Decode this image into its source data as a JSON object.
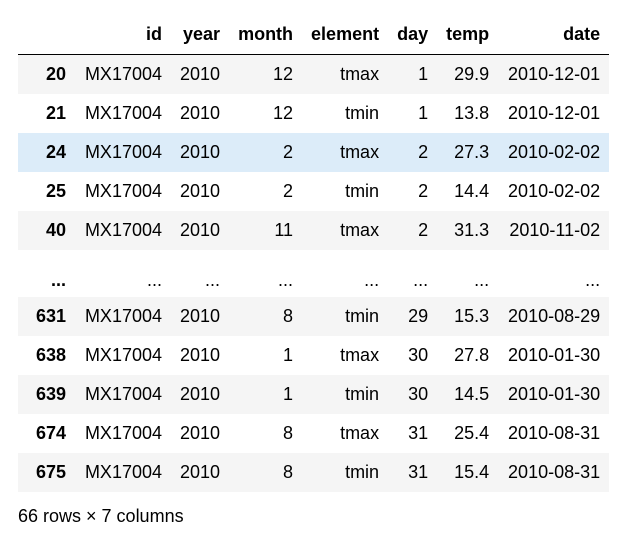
{
  "table": {
    "columns": [
      "",
      "id",
      "year",
      "month",
      "element",
      "day",
      "temp",
      "date"
    ],
    "rows": [
      {
        "index": "20",
        "id": "MX17004",
        "year": "2010",
        "month": "12",
        "element": "tmax",
        "day": "1",
        "temp": "29.9",
        "date": "2010-12-01"
      },
      {
        "index": "21",
        "id": "MX17004",
        "year": "2010",
        "month": "12",
        "element": "tmin",
        "day": "1",
        "temp": "13.8",
        "date": "2010-12-01"
      },
      {
        "index": "24",
        "id": "MX17004",
        "year": "2010",
        "month": "2",
        "element": "tmax",
        "day": "2",
        "temp": "27.3",
        "date": "2010-02-02"
      },
      {
        "index": "25",
        "id": "MX17004",
        "year": "2010",
        "month": "2",
        "element": "tmin",
        "day": "2",
        "temp": "14.4",
        "date": "2010-02-02"
      },
      {
        "index": "40",
        "id": "MX17004",
        "year": "2010",
        "month": "11",
        "element": "tmax",
        "day": "2",
        "temp": "31.3",
        "date": "2010-11-02"
      },
      {
        "index": "...",
        "id": "...",
        "year": "...",
        "month": "...",
        "element": "...",
        "day": "...",
        "temp": "...",
        "date": "..."
      },
      {
        "index": "631",
        "id": "MX17004",
        "year": "2010",
        "month": "8",
        "element": "tmin",
        "day": "29",
        "temp": "15.3",
        "date": "2010-08-29"
      },
      {
        "index": "638",
        "id": "MX17004",
        "year": "2010",
        "month": "1",
        "element": "tmax",
        "day": "30",
        "temp": "27.8",
        "date": "2010-01-30"
      },
      {
        "index": "639",
        "id": "MX17004",
        "year": "2010",
        "month": "1",
        "element": "tmin",
        "day": "30",
        "temp": "14.5",
        "date": "2010-01-30"
      },
      {
        "index": "674",
        "id": "MX17004",
        "year": "2010",
        "month": "8",
        "element": "tmax",
        "day": "31",
        "temp": "25.4",
        "date": "2010-08-31"
      },
      {
        "index": "675",
        "id": "MX17004",
        "year": "2010",
        "month": "8",
        "element": "tmin",
        "day": "31",
        "temp": "15.4",
        "date": "2010-08-31"
      }
    ]
  },
  "caption": "66 rows × 7 columns",
  "colors": {
    "stripe": "#f5f5f5",
    "hover": "#dcecf9",
    "header_border": "#000000"
  }
}
